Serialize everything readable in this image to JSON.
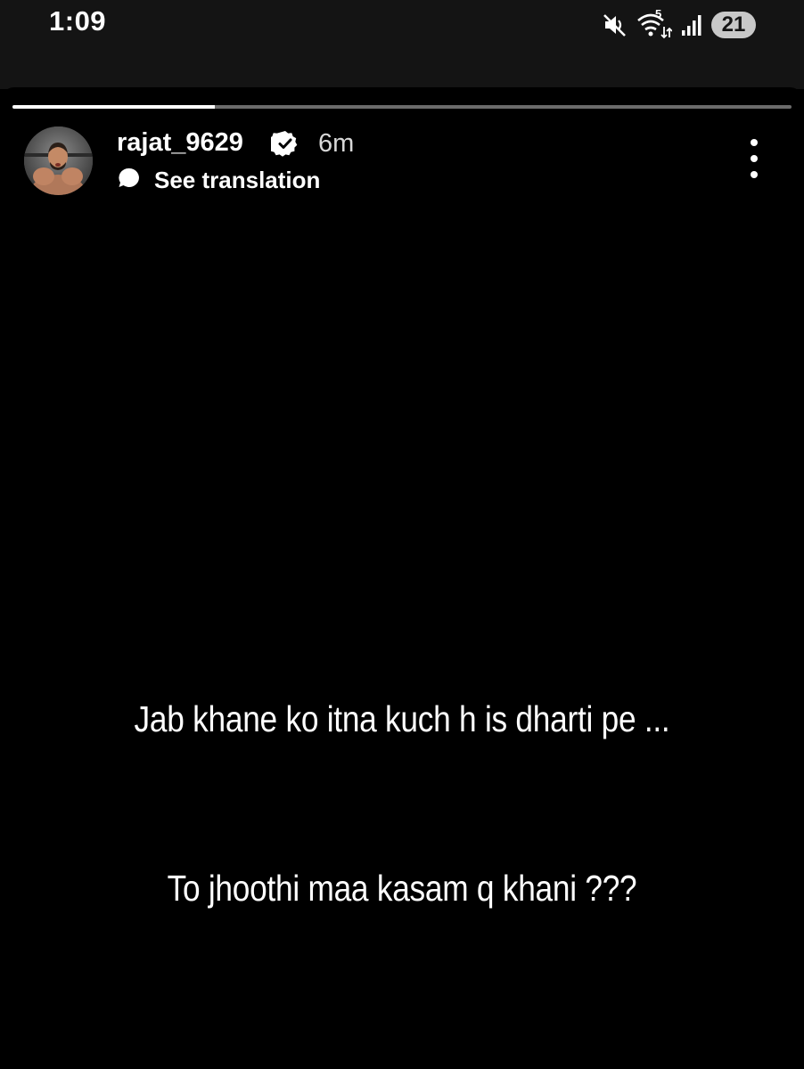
{
  "status_bar": {
    "time": "1:09",
    "battery_level": "21",
    "wifi_label": "5",
    "icons": [
      "mute-icon",
      "wifi-icon",
      "signal-icon",
      "battery-icon"
    ]
  },
  "story": {
    "progress_fraction": 0.26,
    "username": "rajat_9629",
    "verified": true,
    "time_ago": "6m",
    "translation_label": "See translation",
    "text_lines": [
      "Jab khane ko itna kuch h is dharti pe ...",
      "To jhoothi maa kasam q khani ???"
    ]
  },
  "colors": {
    "background": "#000000",
    "status_bar_bg": "#141414",
    "text": "#ffffff",
    "progress_track": "#6b6b6b",
    "battery_badge": "#c8c8c8"
  }
}
